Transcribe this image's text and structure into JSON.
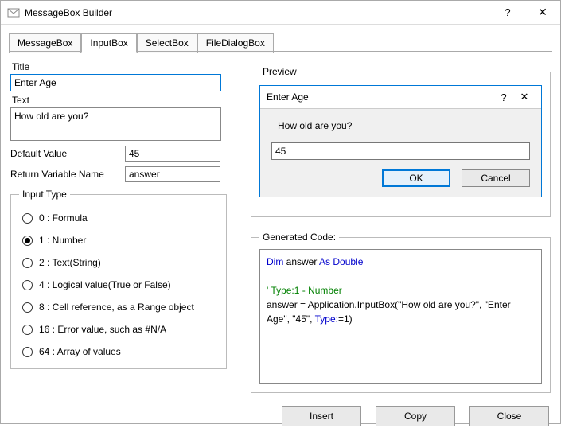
{
  "window": {
    "title": "MessageBox Builder"
  },
  "tabs": {
    "items": [
      "MessageBox",
      "InputBox",
      "SelectBox",
      "FileDialogBox"
    ],
    "active": 1
  },
  "form": {
    "title_label": "Title",
    "title_value": "Enter Age",
    "text_label": "Text",
    "text_value": "How old are you?",
    "default_label": "Default Value",
    "default_value": "45",
    "return_label": "Return Variable Name",
    "return_value": "answer"
  },
  "input_type": {
    "legend": "Input Type",
    "options": [
      "0 : Formula",
      "1 : Number",
      "2 : Text(String)",
      "4 : Logical value(True or False)",
      "8 : Cell reference, as a Range object",
      "16 : Error value, such as #N/A",
      "64 : Array of values"
    ],
    "selected": 1
  },
  "preview": {
    "legend": "Preview",
    "title": "Enter Age",
    "prompt": "How old are you?",
    "value": "45",
    "ok": "OK",
    "cancel": "Cancel"
  },
  "code": {
    "legend": "Generated Code:",
    "l1a": "Dim",
    "l1b": " answer ",
    "l1c": "As Double",
    "l2": "' Type:1 - Number",
    "l3a": "answer = Application.InputBox(\"How old are you?\", \"Enter Age\", \"45\", ",
    "l3b": "Type:",
    "l3c": "=1)"
  },
  "footer": {
    "insert": "Insert",
    "copy": "Copy",
    "close": "Close"
  }
}
